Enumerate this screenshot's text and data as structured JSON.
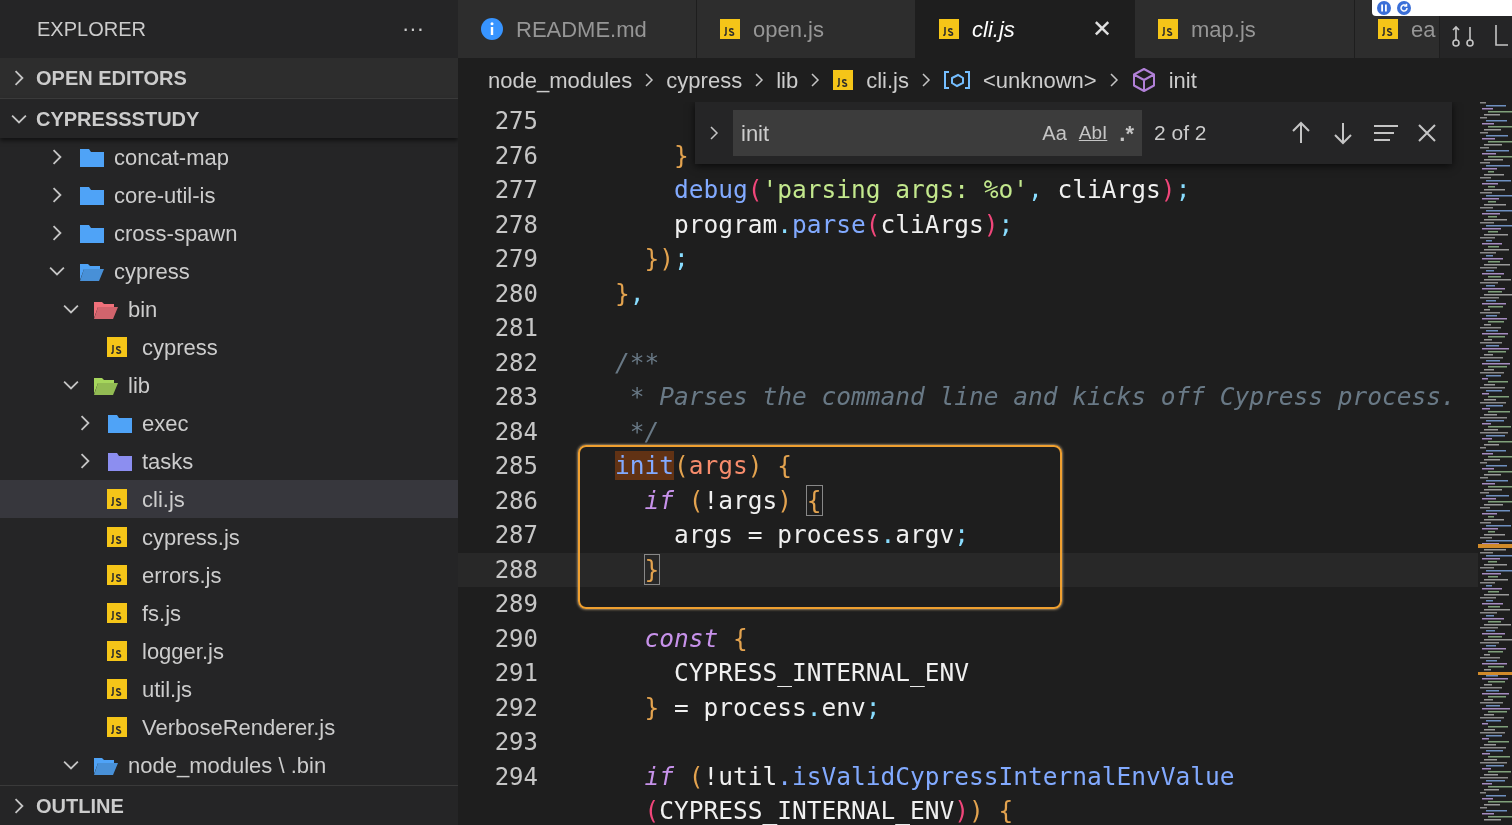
{
  "sidebar": {
    "title": "EXPLORER",
    "more": "···",
    "sections": [
      {
        "label": "OPEN EDITORS",
        "expanded": false
      },
      {
        "label": "CYPRESSSTUDY",
        "expanded": true
      }
    ],
    "tree": [
      {
        "label": "concat-map",
        "kind": "folder",
        "color": "#4fa3f7",
        "expanded": false,
        "selected": false
      },
      {
        "label": "core-util-is",
        "kind": "folder",
        "color": "#4fa3f7",
        "expanded": false,
        "selected": false
      },
      {
        "label": "cross-spawn",
        "kind": "folder",
        "color": "#4fa3f7",
        "expanded": false,
        "selected": false
      },
      {
        "label": "cypress",
        "kind": "folder",
        "color": "#4fa3f7",
        "expanded": true,
        "selected": false,
        "children": [
          {
            "label": "bin",
            "kind": "folder",
            "color": "#f0707a",
            "expanded": true,
            "selected": false,
            "children": [
              {
                "label": "cypress",
                "kind": "js",
                "selected": false
              }
            ]
          },
          {
            "label": "lib",
            "kind": "folder",
            "color": "#a6d65c",
            "expanded": true,
            "selected": false,
            "children": [
              {
                "label": "exec",
                "kind": "folder",
                "color": "#4fa3f7",
                "expanded": false,
                "selected": false
              },
              {
                "label": "tasks",
                "kind": "folder",
                "color": "#8c8ef0",
                "expanded": false,
                "selected": false
              },
              {
                "label": "cli.js",
                "kind": "js",
                "selected": true
              },
              {
                "label": "cypress.js",
                "kind": "js",
                "selected": false
              },
              {
                "label": "errors.js",
                "kind": "js",
                "selected": false
              },
              {
                "label": "fs.js",
                "kind": "js",
                "selected": false
              },
              {
                "label": "logger.js",
                "kind": "js",
                "selected": false
              },
              {
                "label": "util.js",
                "kind": "js",
                "selected": false
              },
              {
                "label": "VerboseRenderer.js",
                "kind": "js",
                "selected": false
              }
            ]
          },
          {
            "label": "node_modules \\ .bin",
            "kind": "folder",
            "color": "#4fa3f7",
            "expanded": true,
            "selected": false
          }
        ]
      }
    ],
    "bottom_section": {
      "label": "OUTLINE",
      "expanded": false
    }
  },
  "tabs": [
    {
      "label": "README.md",
      "kind": "info",
      "selected": false
    },
    {
      "label": "open.js",
      "kind": "js",
      "selected": false
    },
    {
      "label": "cli.js",
      "kind": "js",
      "selected": true,
      "close": "✕"
    },
    {
      "label": "map.js",
      "kind": "js",
      "selected": false
    },
    {
      "label": "ea",
      "kind": "js",
      "selected": false
    }
  ],
  "breadcrumbs": [
    {
      "label": "node_modules",
      "kind": "text"
    },
    {
      "label": "cypress",
      "kind": "text"
    },
    {
      "label": "lib",
      "kind": "text"
    },
    {
      "label": "cli.js",
      "kind": "js"
    },
    {
      "label": "<unknown>",
      "kind": "variable"
    },
    {
      "label": "init",
      "kind": "method"
    }
  ],
  "find_widget": {
    "value": "init",
    "match_case": "Aa",
    "whole_word": "AbI",
    "regex": ".*",
    "result": "2 of 2"
  },
  "editor": {
    "lines": [
      {
        "number": "275"
      },
      {
        "number": "276",
        "tokens": [
          {
            "text": "        }",
            "kind": "brace"
          }
        ]
      },
      {
        "number": "277",
        "tokens": [
          {
            "text": "        debug",
            "kind": "fn"
          },
          {
            "text": "(",
            "kind": "paren"
          },
          {
            "text": "'parsing args: %o'",
            "kind": "string"
          },
          {
            "text": ",",
            "kind": "punct"
          },
          {
            "text": " cliArgs",
            "kind": "plain"
          },
          {
            "text": ")",
            "kind": "paren"
          },
          {
            "text": ";",
            "kind": "punct"
          }
        ]
      },
      {
        "number": "278",
        "tokens": [
          {
            "text": "        program",
            "kind": "plain"
          },
          {
            "text": ".",
            "kind": "punct"
          },
          {
            "text": "parse",
            "kind": "fn"
          },
          {
            "text": "(",
            "kind": "paren"
          },
          {
            "text": "cliArgs",
            "kind": "plain"
          },
          {
            "text": ")",
            "kind": "paren"
          },
          {
            "text": ";",
            "kind": "punct"
          }
        ]
      },
      {
        "number": "279",
        "tokens": [
          {
            "text": "      })",
            "kind": "brace"
          },
          {
            "text": ";",
            "kind": "punct"
          }
        ]
      },
      {
        "number": "280",
        "tokens": [
          {
            "text": "    }",
            "kind": "brace"
          },
          {
            "text": ",",
            "kind": "punct"
          }
        ]
      },
      {
        "number": "281"
      },
      {
        "number": "282",
        "tokens": [
          {
            "text": "    /**",
            "kind": "comment"
          }
        ]
      },
      {
        "number": "283",
        "tokens": [
          {
            "text": "     * Parses the command line and kicks off Cypress process.",
            "kind": "comment"
          }
        ]
      },
      {
        "number": "284",
        "tokens": [
          {
            "text": "     */",
            "kind": "comment"
          }
        ]
      },
      {
        "number": "285",
        "boxed": true,
        "tokens": [
          {
            "text": "    init",
            "kind": "match"
          },
          {
            "text": "(",
            "kind": "brace"
          },
          {
            "text": "args",
            "kind": "param"
          },
          {
            "text": ")",
            "kind": "brace"
          },
          {
            "text": " {",
            "kind": "brace"
          }
        ]
      },
      {
        "number": "286",
        "boxed": true,
        "tokens": [
          {
            "text": "      if",
            "kind": "keyword"
          },
          {
            "text": " (",
            "kind": "brace"
          },
          {
            "text": "!args",
            "kind": "plain"
          },
          {
            "text": ")",
            "kind": "brace"
          },
          {
            "text": " {",
            "kind": "bracket_match"
          }
        ]
      },
      {
        "number": "287",
        "boxed": true,
        "tokens": [
          {
            "text": "        args = process",
            "kind": "plain"
          },
          {
            "text": ".",
            "kind": "punct"
          },
          {
            "text": "argv",
            "kind": "plain"
          },
          {
            "text": ";",
            "kind": "punct"
          }
        ]
      },
      {
        "number": "288",
        "boxed": true,
        "current": true,
        "tokens": [
          {
            "text": "      }",
            "kind": "bracket_match"
          }
        ]
      },
      {
        "number": "289"
      },
      {
        "number": "290",
        "tokens": [
          {
            "text": "      const",
            "kind": "keyword"
          },
          {
            "text": " {",
            "kind": "brace"
          }
        ]
      },
      {
        "number": "291",
        "tokens": [
          {
            "text": "        CYPRESS_INTERNAL_ENV",
            "kind": "plain"
          }
        ]
      },
      {
        "number": "292",
        "tokens": [
          {
            "text": "      }",
            "kind": "brace"
          },
          {
            "text": " = process",
            "kind": "plain"
          },
          {
            "text": ".",
            "kind": "punct"
          },
          {
            "text": "env",
            "kind": "plain"
          },
          {
            "text": ";",
            "kind": "punct"
          }
        ]
      },
      {
        "number": "293"
      },
      {
        "number": "294",
        "tokens": [
          {
            "text": "      if",
            "kind": "keyword"
          },
          {
            "text": " (",
            "kind": "brace"
          },
          {
            "text": "!util",
            "kind": "plain"
          },
          {
            "text": ".isValidCypressInternalEnvValue",
            "kind": "fn"
          }
        ]
      },
      {
        "tokens": [
          {
            "text": "      (",
            "kind": "paren"
          },
          {
            "text": "CYPRESS_INTERNAL_ENV",
            "kind": "plain"
          },
          {
            "text": ")",
            "kind": "paren"
          },
          {
            "text": ")",
            "kind": "brace"
          },
          {
            "text": " {",
            "kind": "brace"
          }
        ]
      }
    ]
  }
}
